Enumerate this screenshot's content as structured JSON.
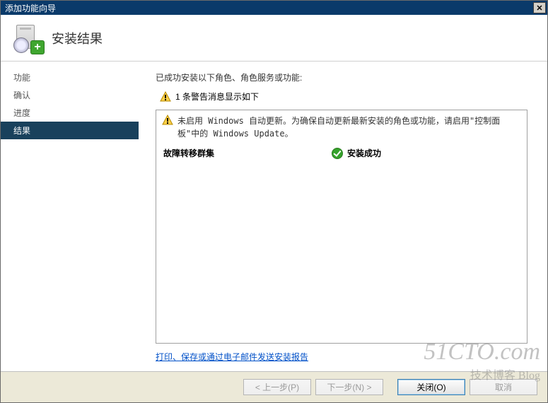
{
  "window": {
    "title": "添加功能向导",
    "close_glyph": "✕"
  },
  "header": {
    "title": "安装结果"
  },
  "sidebar": {
    "items": [
      {
        "label": "功能",
        "selected": false
      },
      {
        "label": "确认",
        "selected": false
      },
      {
        "label": "进度",
        "selected": false
      },
      {
        "label": "结果",
        "selected": true
      }
    ]
  },
  "content": {
    "intro": "已成功安装以下角色、角色服务或功能:",
    "warning_summary": "1 条警告消息显示如下",
    "update_warning": "未启用 Windows 自动更新。为确保自动更新最新安装的角色或功能，请启用\"控制面板\"中的 Windows Update。",
    "feature_name": "故障转移群集",
    "status_text": "安装成功",
    "report_link": "打印、保存或通过电子邮件发送安装报告"
  },
  "footer": {
    "back": "< 上一步(P)",
    "next": "下一步(N) >",
    "close": "关闭(O)",
    "cancel": "取消"
  },
  "watermark": {
    "main": "51CTO.com",
    "sub": "技术博客  Blog"
  }
}
